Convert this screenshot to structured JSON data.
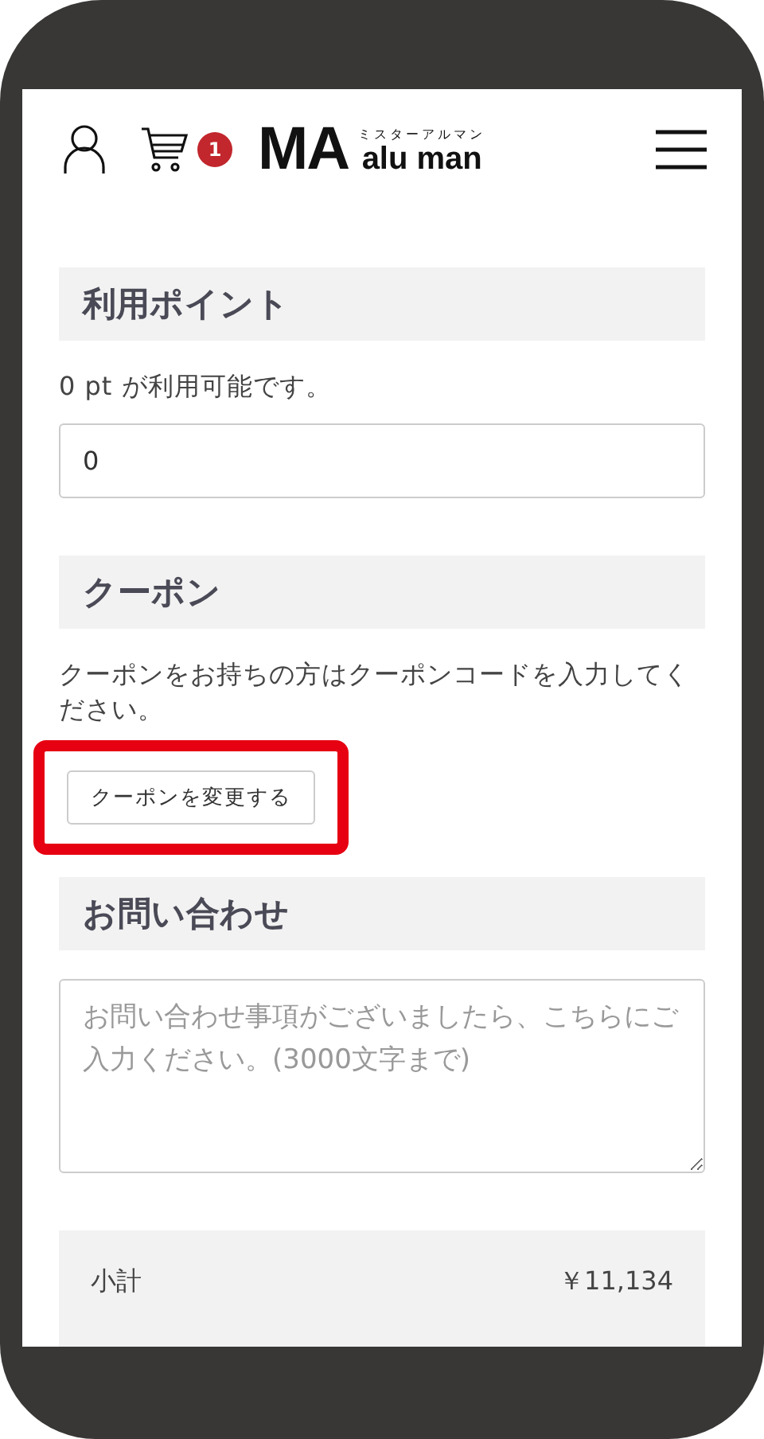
{
  "header": {
    "cart_count": "1",
    "logo": {
      "mark": "MA",
      "ruby": "ミスターアルマン",
      "name": "alu man"
    }
  },
  "sections": [
    {
      "kind": "points",
      "title": "利用ポイント",
      "note": "0 pt が利用可能です。",
      "value": "0"
    },
    {
      "kind": "coupon",
      "title": "クーポン",
      "note": "クーポンをお持ちの方はクーポンコードを入力してください。",
      "button": "クーポンを変更する",
      "highlighted": true
    },
    {
      "kind": "inquiry",
      "title": "お問い合わせ",
      "placeholder": "お問い合わせ事項がございましたら、こちらにご入力ください。(3000文字まで)"
    }
  ],
  "summary": [
    {
      "label": "小計",
      "value": "￥11,134"
    }
  ]
}
